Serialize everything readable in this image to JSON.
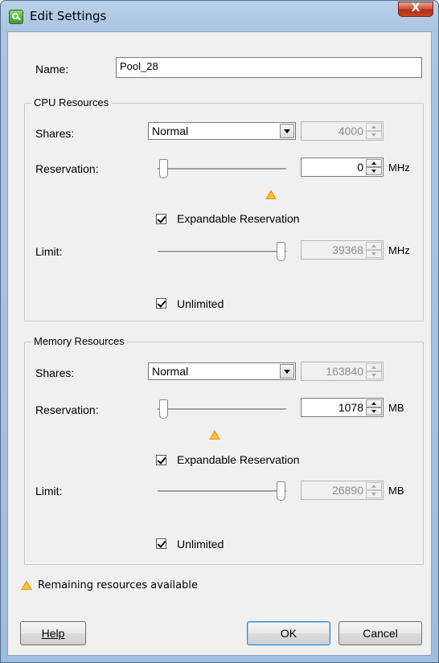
{
  "window": {
    "title": "Edit Settings",
    "close_label": "X",
    "icon": "resource-pool-icon"
  },
  "name": {
    "label": "Name:",
    "value": "Pool_28"
  },
  "cpu": {
    "group_title": "CPU Resources",
    "shares_label": "Shares:",
    "shares_level": "Normal",
    "shares_value": "4000",
    "reservation_label": "Reservation:",
    "reservation_value": "0",
    "reservation_unit": "MHz",
    "expandable_label": "Expandable Reservation",
    "expandable_checked": true,
    "limit_label": "Limit:",
    "limit_value": "39368",
    "limit_unit": "MHz",
    "unlimited_label": "Unlimited",
    "unlimited_checked": true
  },
  "memory": {
    "group_title": "Memory Resources",
    "shares_label": "Shares:",
    "shares_level": "Normal",
    "shares_value": "163840",
    "reservation_label": "Reservation:",
    "reservation_value": "1078",
    "reservation_unit": "MB",
    "expandable_label": "Expandable Reservation",
    "expandable_checked": true,
    "limit_label": "Limit:",
    "limit_value": "26890",
    "limit_unit": "MB",
    "unlimited_label": "Unlimited",
    "unlimited_checked": true
  },
  "legend": {
    "text": "Remaining resources available",
    "icon": "warning-triangle-icon"
  },
  "buttons": {
    "help": "Help",
    "ok": "OK",
    "cancel": "Cancel"
  },
  "colors": {
    "accent_triangle": "#e89b16",
    "title_bar": "#b9d1ea",
    "close_button": "#c9452a"
  }
}
